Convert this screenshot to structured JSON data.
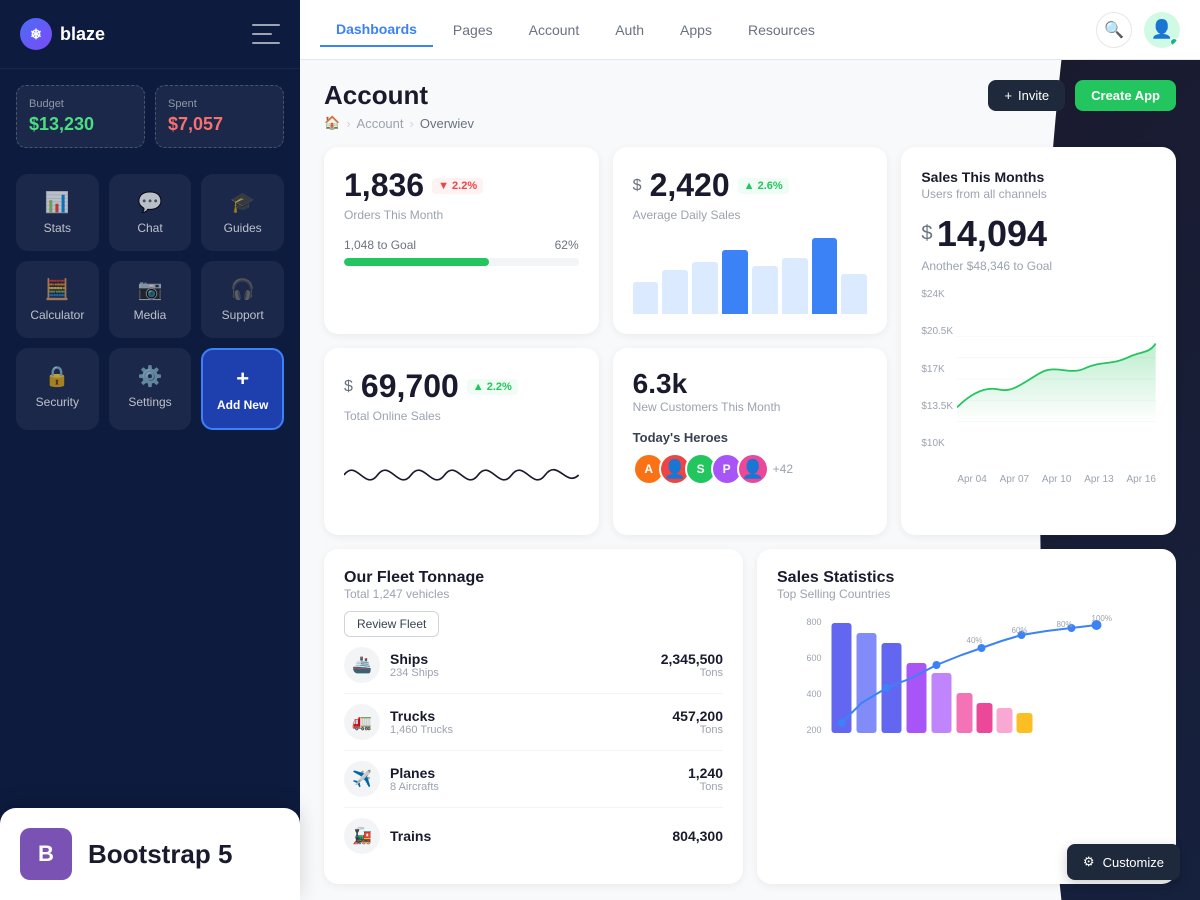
{
  "app": {
    "name": "blaze"
  },
  "sidebar": {
    "budget": {
      "label": "Budget",
      "value": "$13,230"
    },
    "spent": {
      "label": "Spent",
      "value": "$7,057"
    },
    "nav_items": [
      {
        "id": "stats",
        "label": "Stats",
        "icon": "📊"
      },
      {
        "id": "chat",
        "label": "Chat",
        "icon": "💬"
      },
      {
        "id": "guides",
        "label": "Guides",
        "icon": "🎓"
      },
      {
        "id": "calculator",
        "label": "Calculator",
        "icon": "🧮"
      },
      {
        "id": "media",
        "label": "Media",
        "icon": "📷"
      },
      {
        "id": "support",
        "label": "Support",
        "icon": "🎧"
      },
      {
        "id": "security",
        "label": "Security",
        "icon": "🔒"
      },
      {
        "id": "settings",
        "label": "Settings",
        "icon": "⚙️"
      },
      {
        "id": "addnew",
        "label": "Add New",
        "icon": "+"
      }
    ],
    "bootstrap": {
      "label": "Bootstrap 5",
      "icon": "B"
    }
  },
  "topnav": {
    "items": [
      {
        "id": "dashboards",
        "label": "Dashboards",
        "active": true
      },
      {
        "id": "pages",
        "label": "Pages"
      },
      {
        "id": "account",
        "label": "Account"
      },
      {
        "id": "auth",
        "label": "Auth"
      },
      {
        "id": "apps",
        "label": "Apps"
      },
      {
        "id": "resources",
        "label": "Resources"
      }
    ]
  },
  "header": {
    "title": "Account",
    "breadcrumb": {
      "home": "🏠",
      "parent": "Account",
      "current": "Overwiev"
    },
    "invite_label": "Invite",
    "create_app_label": "Create App"
  },
  "stats": {
    "orders": {
      "value": "1,836",
      "label": "Orders This Month",
      "badge": "▼ 2.2%",
      "badge_type": "red",
      "goal_label": "1,048 to Goal",
      "goal_pct": "62%",
      "progress": 62
    },
    "avg_sales": {
      "prefix": "$",
      "value": "2,420",
      "label": "Average Daily Sales",
      "badge": "▲ 2.6%",
      "badge_type": "green"
    },
    "sales_this_month": {
      "title": "Sales This Months",
      "sub": "Users from all channels",
      "prefix": "$",
      "value": "14,094",
      "another": "Another $48,346 to Goal"
    },
    "total_online": {
      "prefix": "$",
      "value": "69,700",
      "label": "Total Online Sales",
      "badge": "▲ 2.2%",
      "badge_type": "green"
    },
    "new_customers": {
      "value": "6.3k",
      "label": "New Customers This Month"
    }
  },
  "heroes": {
    "title": "Today's Heroes",
    "count": "+42",
    "avatars": [
      {
        "color": "#f97316",
        "initial": "A"
      },
      {
        "color": "#ef4444",
        "initial": ""
      },
      {
        "color": "#22c55e",
        "initial": "S"
      },
      {
        "color": "#a855f7",
        "initial": "P"
      },
      {
        "color": "#ec4899",
        "initial": ""
      }
    ]
  },
  "sales_chart": {
    "y_labels": [
      "$24K",
      "$20.5K",
      "$17K",
      "$13.5K",
      "$10K"
    ],
    "x_labels": [
      "Apr 04",
      "Apr 07",
      "Apr 10",
      "Apr 13",
      "Apr 16"
    ]
  },
  "fleet": {
    "title": "Our Fleet Tonnage",
    "subtitle": "Total 1,247 vehicles",
    "review_btn": "Review Fleet",
    "items": [
      {
        "name": "Ships",
        "sub": "234 Ships",
        "value": "2,345,500",
        "unit": "Tons",
        "icon": "🚢"
      },
      {
        "name": "Trucks",
        "sub": "1,460 Trucks",
        "value": "457,200",
        "unit": "Tons",
        "icon": "🚛"
      },
      {
        "name": "Planes",
        "sub": "8 Aircrafts",
        "value": "1,240",
        "unit": "Tons",
        "icon": "✈️"
      },
      {
        "name": "Trains",
        "sub": "",
        "value": "804,300",
        "unit": "",
        "icon": "🚂"
      }
    ]
  },
  "sales_stats": {
    "title": "Sales Statistics",
    "subtitle": "Top Selling Countries",
    "y_labels": [
      "800",
      "600",
      "400",
      "200"
    ],
    "x_labels": [
      "100%",
      "80%",
      "60%",
      "40%"
    ]
  },
  "customize": {
    "label": "Customize"
  }
}
